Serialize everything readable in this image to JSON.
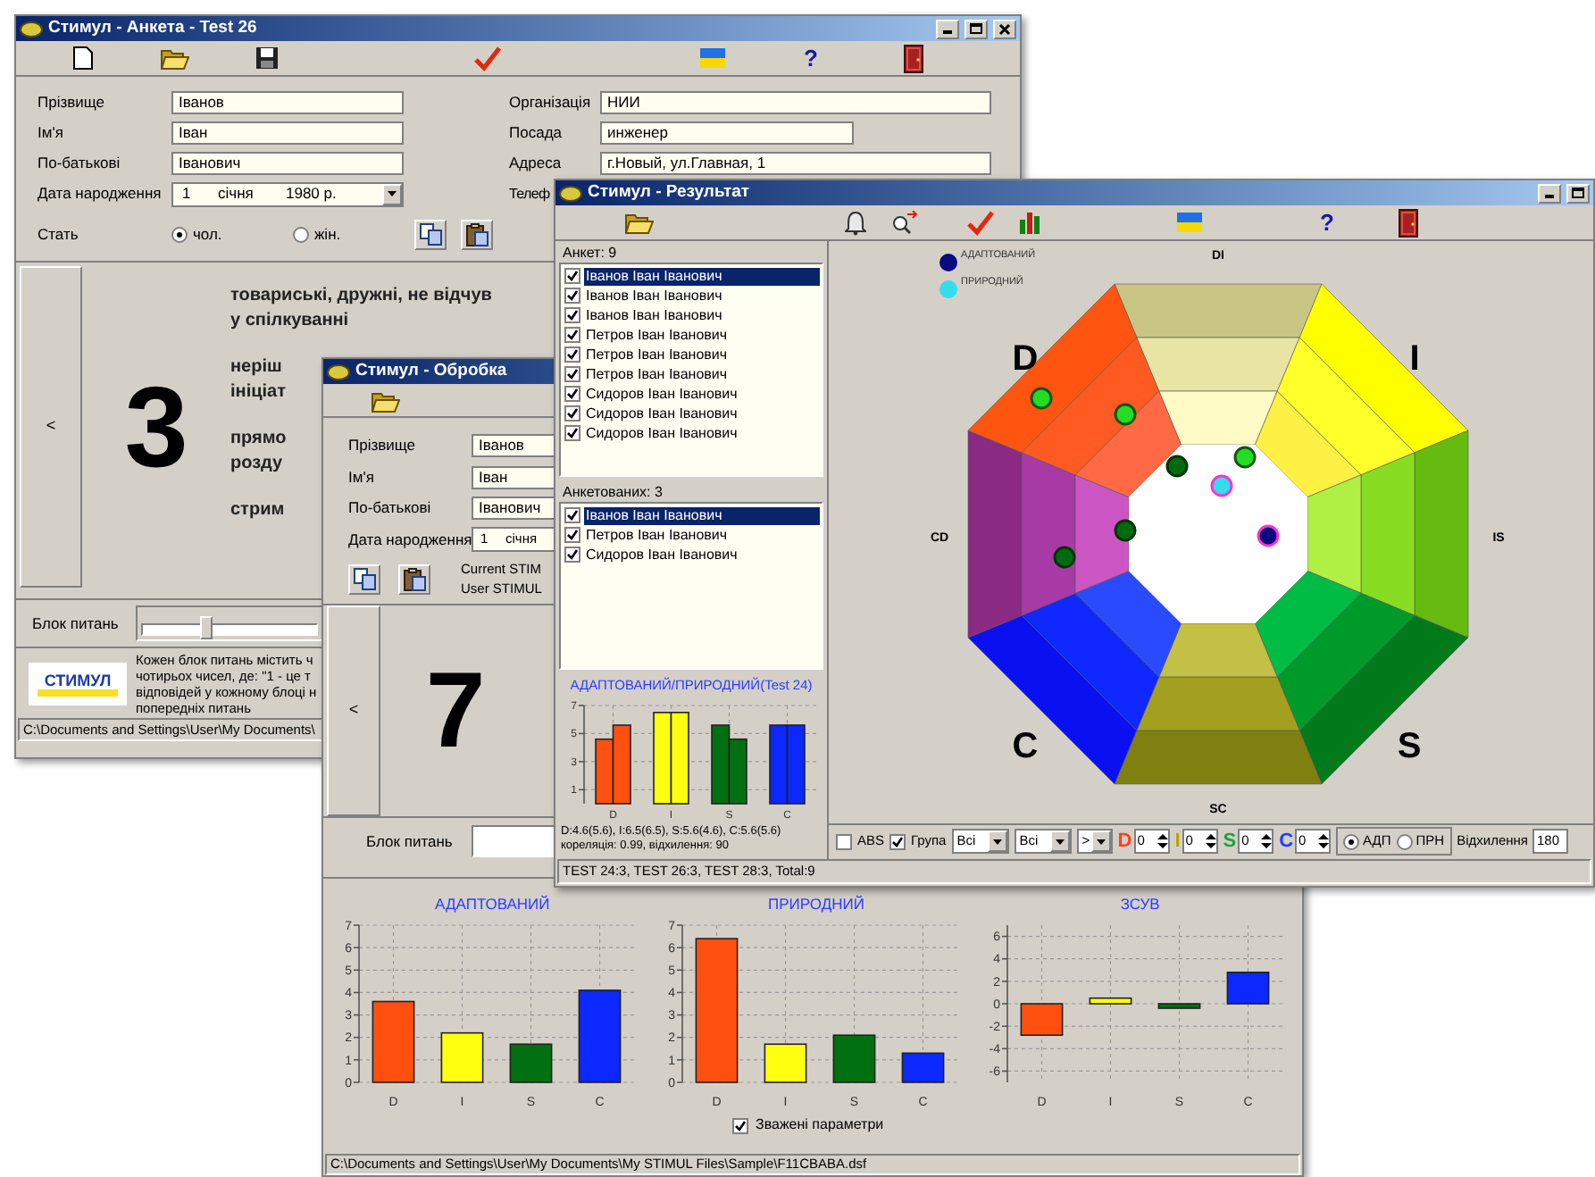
{
  "anketa_window": {
    "title": "Стимул - Анкета - Test 26",
    "help": "?",
    "fields_left": [
      {
        "label": "Прізвище",
        "value": "Іванов"
      },
      {
        "label": "Ім'я",
        "value": "Іван"
      },
      {
        "label": "По-батькові",
        "value": "Іванович"
      }
    ],
    "birth_date": {
      "label": "Дата народження",
      "day": "1",
      "month": "січня",
      "year": "1980 р."
    },
    "sex": {
      "label": "Стать",
      "options": [
        {
          "label": "чол.",
          "selected": true
        },
        {
          "label": "жін.",
          "selected": false
        }
      ]
    },
    "fields_right": [
      {
        "label": "Організація",
        "value": "НИИ"
      },
      {
        "label": "Посада",
        "value": "инженер"
      },
      {
        "label": "Адреса",
        "value": "г.Новый, ул.Главная, 1"
      }
    ],
    "phone_label": "Телеф",
    "question": {
      "nav": "<",
      "number": "3",
      "paragraphs": [
        [
          "товариські, дружні, не відчув",
          "у спілкуванні"
        ],
        [
          "неріш",
          "ініціат"
        ],
        [
          "прямо",
          "розду"
        ],
        [
          "стрим"
        ]
      ]
    },
    "block": {
      "label": "Блок питань",
      "level": 0.38
    },
    "logo": "СТИМУЛ",
    "info_lines": [
      "Кожен блок питань містить ч",
      "чотирьох чисел, де: \"1 - це т",
      "відповідей у кожному блоці н",
      "попередніх питань"
    ],
    "status": "C:\\Documents and Settings\\User\\My Documents\\"
  },
  "result_window": {
    "title": "Стимул - Результат",
    "help": "?",
    "survey_list": {
      "header": "Анкет: 9",
      "items": [
        {
          "name": "Іванов Іван Іванович",
          "checked": true,
          "selected": true
        },
        {
          "name": "Іванов Іван Іванович",
          "checked": true,
          "selected": false
        },
        {
          "name": "Іванов Іван Іванович",
          "checked": true,
          "selected": false
        },
        {
          "name": "Петров Іван Іванович",
          "checked": true,
          "selected": false
        },
        {
          "name": "Петров Іван Іванович",
          "checked": true,
          "selected": false
        },
        {
          "name": "Петров Іван Іванович",
          "checked": true,
          "selected": false
        },
        {
          "name": "Сидоров Іван Іванович",
          "checked": true,
          "selected": false
        },
        {
          "name": "Сидоров Іван Іванович",
          "checked": true,
          "selected": false
        },
        {
          "name": "Сидоров Іван Іванович",
          "checked": true,
          "selected": false
        }
      ]
    },
    "respondent_list": {
      "header": "Анкетованих: 3",
      "items": [
        {
          "name": "Іванов Іван Іванович",
          "checked": true,
          "selected": true
        },
        {
          "name": "Петров Іван Іванович",
          "checked": true,
          "selected": false
        },
        {
          "name": "Сидоров Іван Іванович",
          "checked": true,
          "selected": false
        }
      ]
    },
    "mini_chart": {
      "chart_data": {
        "type": "bar",
        "title": "АДАПТОВАНИЙ/ПРИРОДНИЙ(Test 24)",
        "categories": [
          "D",
          "I",
          "S",
          "C"
        ],
        "series": [
          {
            "colors": [
              "#ff5010",
              "#ffff10",
              "#007010",
              "#0a28ff"
            ],
            "values": [
              4.6,
              6.5,
              5.6,
              5.6
            ]
          },
          {
            "colors": [
              "#ff5010",
              "#ffff10",
              "#007010",
              "#0a28ff"
            ],
            "values": [
              5.6,
              6.5,
              4.6,
              5.6
            ]
          }
        ],
        "ylim": [
          0,
          7
        ],
        "yticks": [
          1,
          3,
          5,
          7
        ],
        "grid": true
      }
    },
    "summary_lines": [
      "D:4.6(5.6), I:6.5(6.5), S:5.6(4.6), C:5.6(5.6)",
      "кореляція: 0.99, відхилення: 90"
    ],
    "disc": {
      "legend": [
        {
          "label": "АДАПТОВАНИЙ",
          "color": "#0a0a80"
        },
        {
          "label": "ПРИРОДНИЙ",
          "color": "#33ddee"
        }
      ],
      "major_labels": [
        "D",
        "I",
        "C",
        "S"
      ],
      "minor_labels": [
        "DI",
        "IS",
        "SC",
        "CD"
      ]
    },
    "controls": {
      "abs": {
        "label": "ABS",
        "checked": false
      },
      "group": {
        "label": "Група",
        "checked": true
      },
      "combos": [
        "Всі",
        "Всі",
        ">"
      ],
      "factors": [
        {
          "letter": "D",
          "color": "#ff4020",
          "value": "0"
        },
        {
          "letter": "I",
          "color": "#b8a400",
          "value": "0"
        },
        {
          "letter": "S",
          "color": "#20a040",
          "value": "0"
        },
        {
          "letter": "C",
          "color": "#2040ff",
          "value": "0"
        }
      ],
      "mode": [
        {
          "label": "АДП",
          "selected": true
        },
        {
          "label": "ПРН",
          "selected": false
        }
      ],
      "deviation": {
        "label": "Відхилення",
        "value": "180"
      }
    },
    "status": "TEST 24:3, TEST 26:3, TEST 28:3, Total:9"
  },
  "processing_window": {
    "title": "Стимул - Обробка",
    "fields": [
      {
        "label": "Прізвище",
        "value": "Іванов"
      },
      {
        "label": "Ім'я",
        "value": "Іван"
      },
      {
        "label": "По-батькові",
        "value": "Іванович"
      }
    ],
    "birth_date": {
      "label": "Дата народження",
      "day": "1",
      "month": "січня"
    },
    "info_lines": [
      "Current STIM",
      "User STIMUL"
    ],
    "question": {
      "nav": "<",
      "number": "7"
    },
    "block": {
      "label": "Блок питань"
    },
    "charts": [
      {
        "chart_data": {
          "type": "bar",
          "title": "АДАПТОВАНИЙ",
          "categories": [
            "D",
            "I",
            "S",
            "C"
          ],
          "series": [
            {
              "colors": [
                "#ff5010",
                "#ffff10",
                "#007010",
                "#0a28ff"
              ],
              "values": [
                3.6,
                2.2,
                1.7,
                4.1
              ]
            }
          ],
          "ylim": [
            0,
            7
          ],
          "yticks": [
            0,
            1,
            2,
            3,
            4,
            5,
            6,
            7
          ],
          "grid": true
        }
      },
      {
        "chart_data": {
          "type": "bar",
          "title": "ПРИРОДНИЙ",
          "categories": [
            "D",
            "I",
            "S",
            "C"
          ],
          "series": [
            {
              "colors": [
                "#ff5010",
                "#ffff10",
                "#007010",
                "#0a28ff"
              ],
              "values": [
                6.4,
                1.7,
                2.1,
                1.3
              ]
            }
          ],
          "ylim": [
            0,
            7
          ],
          "yticks": [
            0,
            1,
            2,
            3,
            4,
            5,
            6,
            7
          ],
          "grid": true
        }
      },
      {
        "chart_data": {
          "type": "bar",
          "title": "ЗСУВ",
          "categories": [
            "D",
            "I",
            "S",
            "C"
          ],
          "series": [
            {
              "colors": [
                "#ff5010",
                "#ffff10",
                "#007010",
                "#0a28ff"
              ],
              "values": [
                -2.8,
                0.5,
                -0.4,
                2.8
              ]
            }
          ],
          "ylim": [
            -7,
            7
          ],
          "yticks": [
            -6,
            -4,
            -2,
            0,
            2,
            4,
            6
          ],
          "grid": true
        }
      }
    ],
    "weighted": {
      "label": "Зважені параметри",
      "checked": true
    },
    "status": "C:\\Documents and Settings\\User\\My Documents\\My STIMUL Files\\Sample\\F11CBABA.dsf"
  }
}
